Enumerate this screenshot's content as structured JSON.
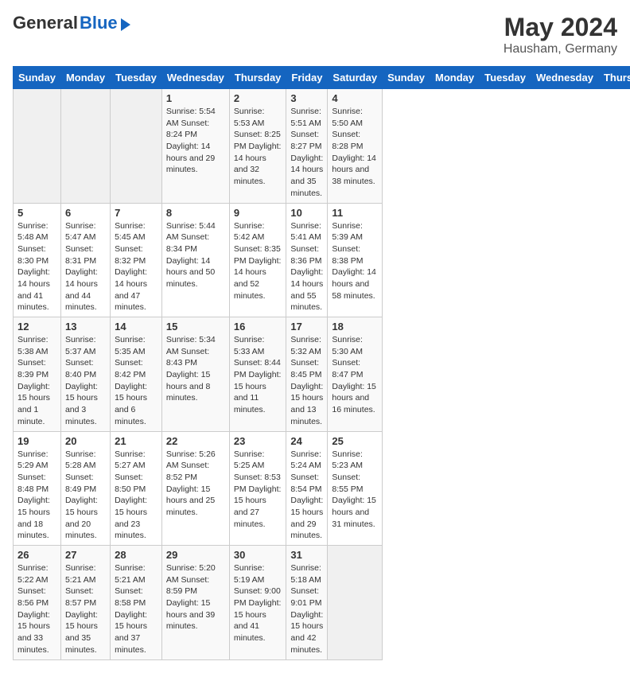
{
  "header": {
    "logo_general": "General",
    "logo_blue": "Blue",
    "month_year": "May 2024",
    "location": "Hausham, Germany"
  },
  "calendar": {
    "weekdays": [
      "Sunday",
      "Monday",
      "Tuesday",
      "Wednesday",
      "Thursday",
      "Friday",
      "Saturday"
    ],
    "weeks": [
      [
        {
          "day": "",
          "info": ""
        },
        {
          "day": "",
          "info": ""
        },
        {
          "day": "",
          "info": ""
        },
        {
          "day": "1",
          "info": "Sunrise: 5:54 AM\nSunset: 8:24 PM\nDaylight: 14 hours and 29 minutes."
        },
        {
          "day": "2",
          "info": "Sunrise: 5:53 AM\nSunset: 8:25 PM\nDaylight: 14 hours and 32 minutes."
        },
        {
          "day": "3",
          "info": "Sunrise: 5:51 AM\nSunset: 8:27 PM\nDaylight: 14 hours and 35 minutes."
        },
        {
          "day": "4",
          "info": "Sunrise: 5:50 AM\nSunset: 8:28 PM\nDaylight: 14 hours and 38 minutes."
        }
      ],
      [
        {
          "day": "5",
          "info": "Sunrise: 5:48 AM\nSunset: 8:30 PM\nDaylight: 14 hours and 41 minutes."
        },
        {
          "day": "6",
          "info": "Sunrise: 5:47 AM\nSunset: 8:31 PM\nDaylight: 14 hours and 44 minutes."
        },
        {
          "day": "7",
          "info": "Sunrise: 5:45 AM\nSunset: 8:32 PM\nDaylight: 14 hours and 47 minutes."
        },
        {
          "day": "8",
          "info": "Sunrise: 5:44 AM\nSunset: 8:34 PM\nDaylight: 14 hours and 50 minutes."
        },
        {
          "day": "9",
          "info": "Sunrise: 5:42 AM\nSunset: 8:35 PM\nDaylight: 14 hours and 52 minutes."
        },
        {
          "day": "10",
          "info": "Sunrise: 5:41 AM\nSunset: 8:36 PM\nDaylight: 14 hours and 55 minutes."
        },
        {
          "day": "11",
          "info": "Sunrise: 5:39 AM\nSunset: 8:38 PM\nDaylight: 14 hours and 58 minutes."
        }
      ],
      [
        {
          "day": "12",
          "info": "Sunrise: 5:38 AM\nSunset: 8:39 PM\nDaylight: 15 hours and 1 minute."
        },
        {
          "day": "13",
          "info": "Sunrise: 5:37 AM\nSunset: 8:40 PM\nDaylight: 15 hours and 3 minutes."
        },
        {
          "day": "14",
          "info": "Sunrise: 5:35 AM\nSunset: 8:42 PM\nDaylight: 15 hours and 6 minutes."
        },
        {
          "day": "15",
          "info": "Sunrise: 5:34 AM\nSunset: 8:43 PM\nDaylight: 15 hours and 8 minutes."
        },
        {
          "day": "16",
          "info": "Sunrise: 5:33 AM\nSunset: 8:44 PM\nDaylight: 15 hours and 11 minutes."
        },
        {
          "day": "17",
          "info": "Sunrise: 5:32 AM\nSunset: 8:45 PM\nDaylight: 15 hours and 13 minutes."
        },
        {
          "day": "18",
          "info": "Sunrise: 5:30 AM\nSunset: 8:47 PM\nDaylight: 15 hours and 16 minutes."
        }
      ],
      [
        {
          "day": "19",
          "info": "Sunrise: 5:29 AM\nSunset: 8:48 PM\nDaylight: 15 hours and 18 minutes."
        },
        {
          "day": "20",
          "info": "Sunrise: 5:28 AM\nSunset: 8:49 PM\nDaylight: 15 hours and 20 minutes."
        },
        {
          "day": "21",
          "info": "Sunrise: 5:27 AM\nSunset: 8:50 PM\nDaylight: 15 hours and 23 minutes."
        },
        {
          "day": "22",
          "info": "Sunrise: 5:26 AM\nSunset: 8:52 PM\nDaylight: 15 hours and 25 minutes."
        },
        {
          "day": "23",
          "info": "Sunrise: 5:25 AM\nSunset: 8:53 PM\nDaylight: 15 hours and 27 minutes."
        },
        {
          "day": "24",
          "info": "Sunrise: 5:24 AM\nSunset: 8:54 PM\nDaylight: 15 hours and 29 minutes."
        },
        {
          "day": "25",
          "info": "Sunrise: 5:23 AM\nSunset: 8:55 PM\nDaylight: 15 hours and 31 minutes."
        }
      ],
      [
        {
          "day": "26",
          "info": "Sunrise: 5:22 AM\nSunset: 8:56 PM\nDaylight: 15 hours and 33 minutes."
        },
        {
          "day": "27",
          "info": "Sunrise: 5:21 AM\nSunset: 8:57 PM\nDaylight: 15 hours and 35 minutes."
        },
        {
          "day": "28",
          "info": "Sunrise: 5:21 AM\nSunset: 8:58 PM\nDaylight: 15 hours and 37 minutes."
        },
        {
          "day": "29",
          "info": "Sunrise: 5:20 AM\nSunset: 8:59 PM\nDaylight: 15 hours and 39 minutes."
        },
        {
          "day": "30",
          "info": "Sunrise: 5:19 AM\nSunset: 9:00 PM\nDaylight: 15 hours and 41 minutes."
        },
        {
          "day": "31",
          "info": "Sunrise: 5:18 AM\nSunset: 9:01 PM\nDaylight: 15 hours and 42 minutes."
        },
        {
          "day": "",
          "info": ""
        }
      ]
    ]
  }
}
